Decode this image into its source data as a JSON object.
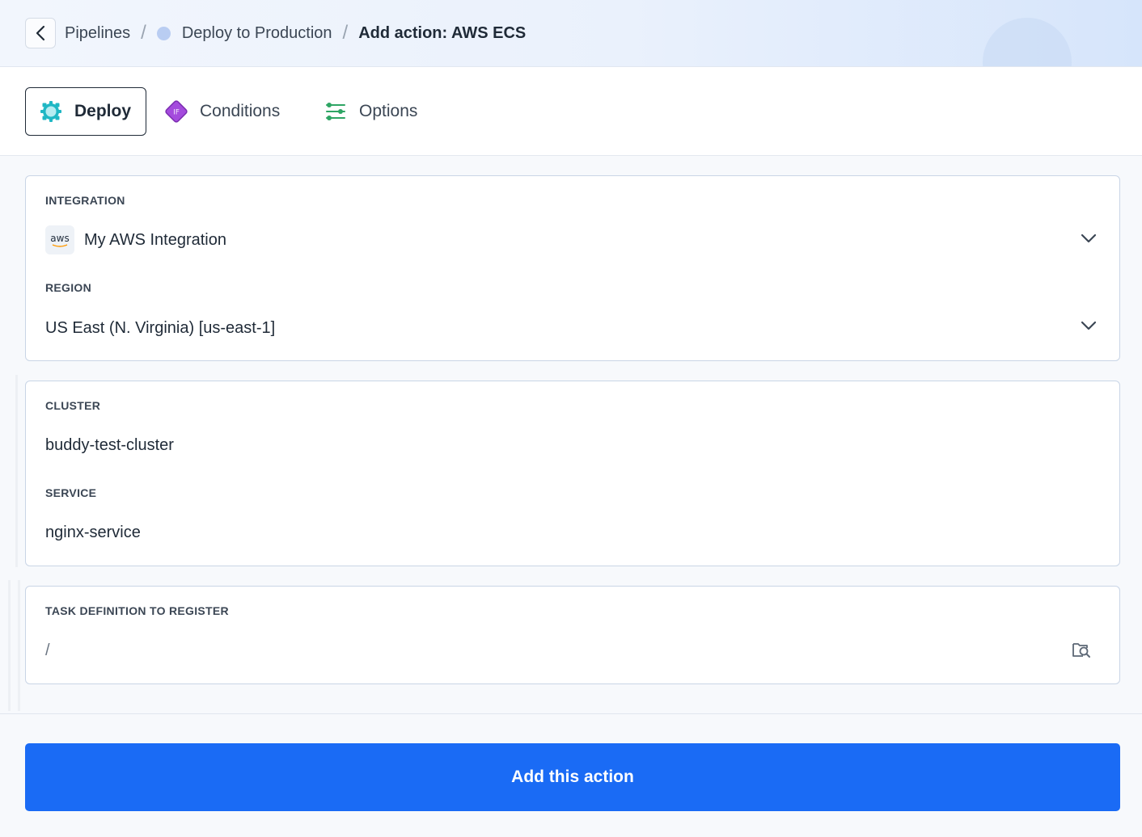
{
  "breadcrumb": {
    "items": [
      "Pipelines",
      "Deploy to Production"
    ],
    "separator": "/",
    "current": "Add action: AWS ECS"
  },
  "tabs": [
    {
      "label": "Deploy",
      "icon": "deploy-gear-icon",
      "active": true
    },
    {
      "label": "Conditions",
      "icon": "if-diamond-icon",
      "active": false
    },
    {
      "label": "Options",
      "icon": "sliders-icon",
      "active": false
    }
  ],
  "integration": {
    "label": "INTEGRATION",
    "badge_text": "aws",
    "value": "My AWS Integration"
  },
  "region": {
    "label": "REGION",
    "value": "US East (N. Virginia) [us-east-1]"
  },
  "cluster": {
    "label": "CLUSTER",
    "value": "buddy-test-cluster"
  },
  "service": {
    "label": "SERVICE",
    "value": "nginx-service"
  },
  "task_definition": {
    "label": "TASK DEFINITION TO REGISTER",
    "value": "/"
  },
  "footer": {
    "submit_label": "Add this action"
  },
  "colors": {
    "primary": "#1a6bf5",
    "deploy_icon": "#1fb7c4",
    "conditions_icon": "#9c3fd6",
    "options_icon": "#2ea564"
  }
}
